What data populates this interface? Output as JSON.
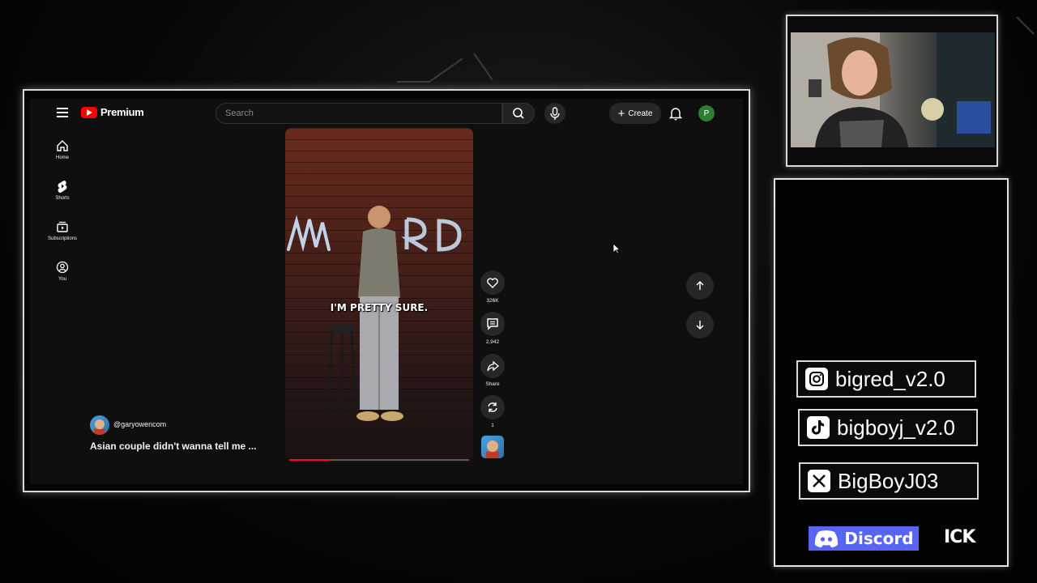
{
  "youtube": {
    "brand": "Premium",
    "search": {
      "placeholder": "Search"
    },
    "create_label": "Create",
    "avatar_letter": "P",
    "sidenav": [
      {
        "label": "Home",
        "icon": "home-icon"
      },
      {
        "label": "Shorts",
        "icon": "shorts-icon"
      },
      {
        "label": "Subscriptions",
        "icon": "subscriptions-icon"
      },
      {
        "label": "You",
        "icon": "you-icon"
      }
    ],
    "short": {
      "caption": "I'm pretty sure.",
      "channel_handle": "@garyowencom",
      "title": "Asian couple didn't wanna tell me ...",
      "progress_fraction": 0.23,
      "actions": {
        "likes": "326K",
        "comments": "2,942",
        "share_label": "Share",
        "remix_count": "1"
      }
    }
  },
  "socials": {
    "instagram": "bigred_v2.0",
    "tiktok": "bigboyj_v2.0",
    "x": "BigBoyJ03",
    "discord_label": "Discord",
    "kick_label": "ICK"
  },
  "colors": {
    "youtube_red": "#ff0000",
    "progress_red": "#ff0033",
    "avatar_green": "#2e7d32",
    "discord_blurple": "#5865f2"
  }
}
